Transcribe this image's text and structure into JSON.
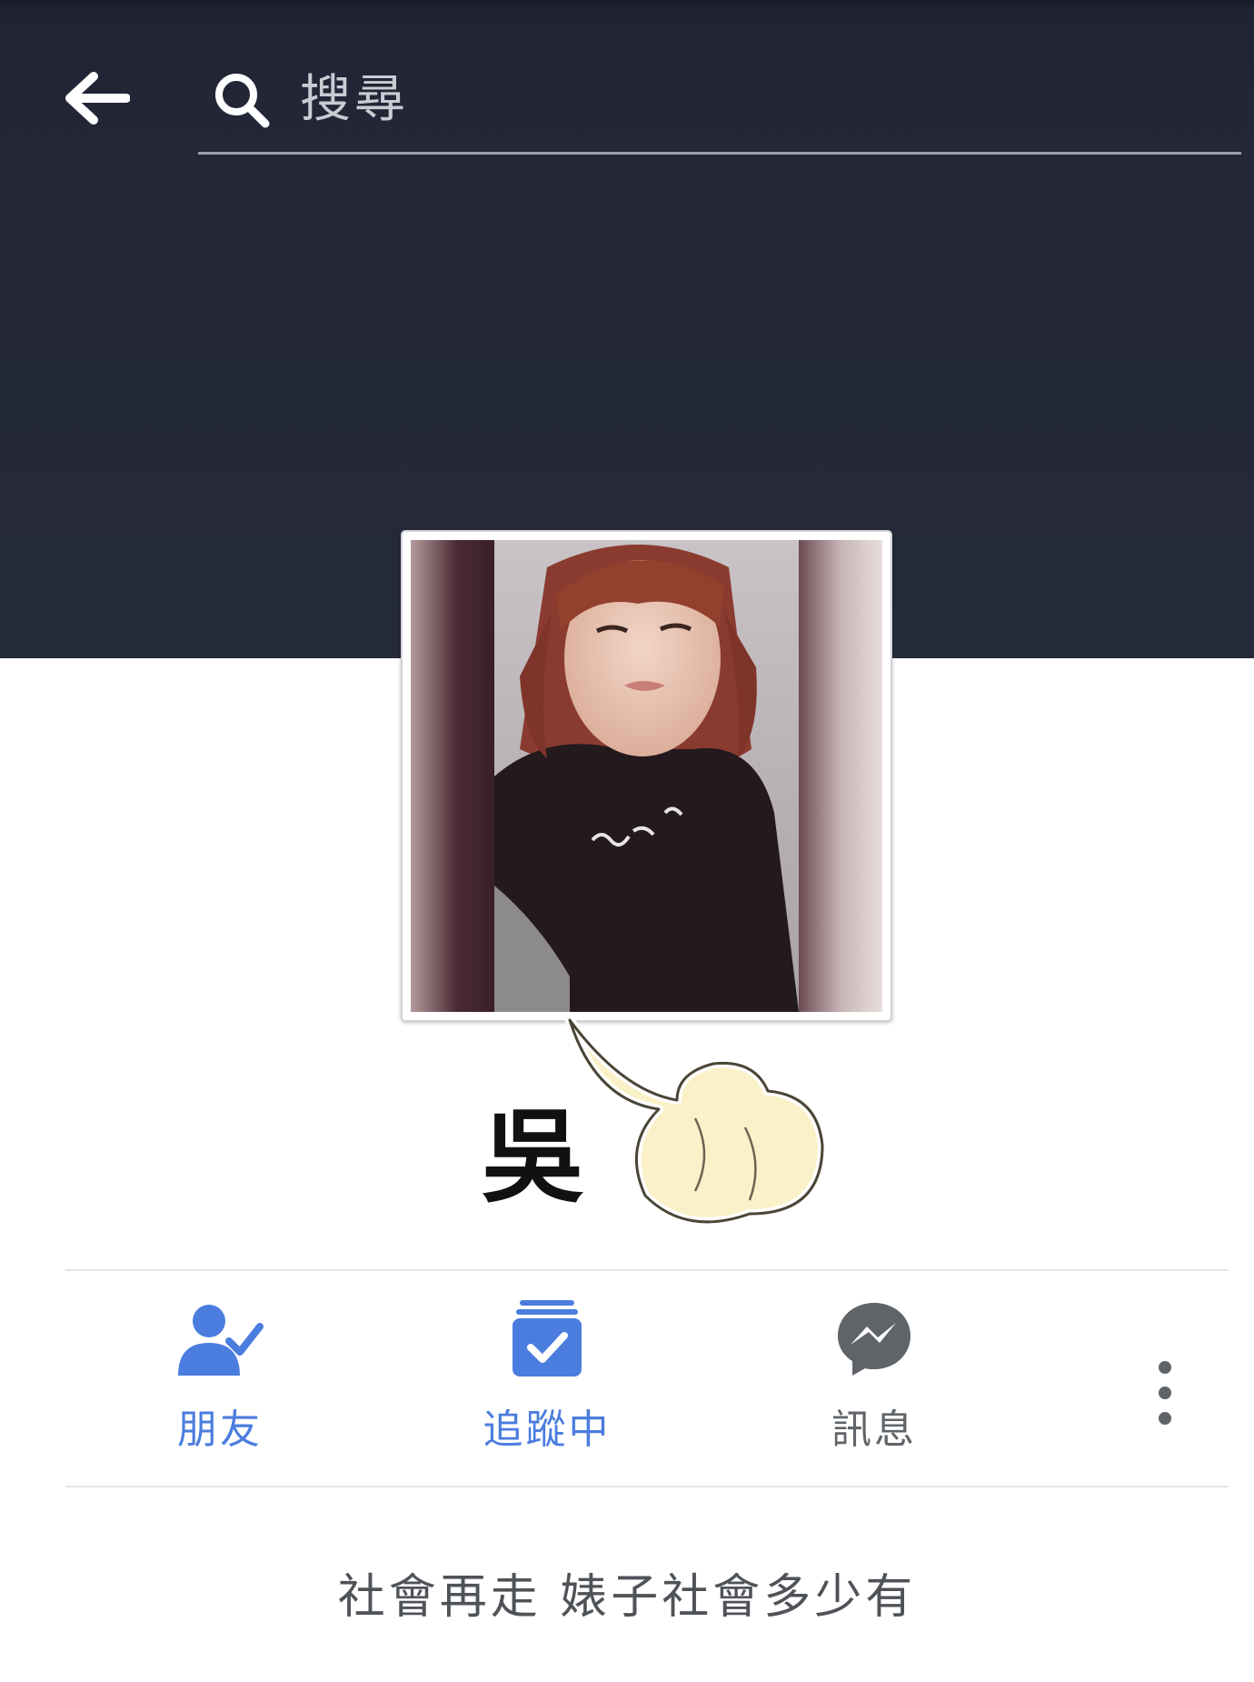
{
  "header": {
    "search_placeholder": "搜尋"
  },
  "profile": {
    "name": "吳",
    "bio": "社會再走 婊子社會多少有"
  },
  "actions": {
    "friends_label": "朋友",
    "following_label": "追蹤中",
    "message_label": "訊息"
  },
  "colors": {
    "cover_bg": "#252a39",
    "action_blue": "#4b7ddf",
    "message_grey": "#5f6469"
  },
  "icons": [
    "back-arrow-icon",
    "search-icon",
    "friends-check-icon",
    "following-check-icon",
    "messenger-icon",
    "more-vertical-icon"
  ]
}
